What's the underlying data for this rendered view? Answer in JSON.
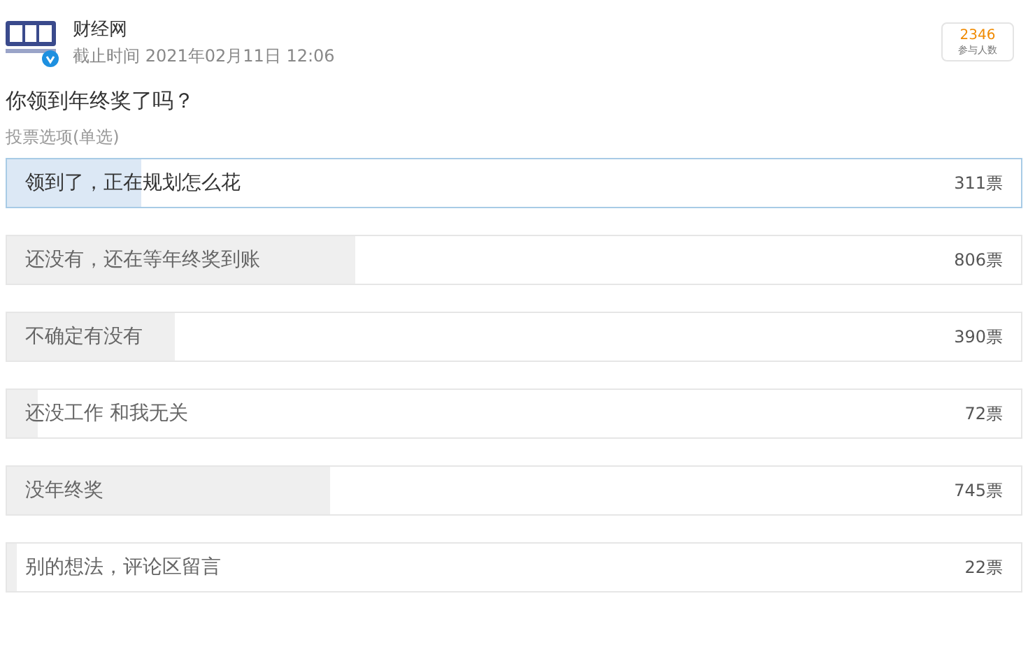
{
  "account": {
    "name": "财经网",
    "deadline": "截止时间 2021年02月11日 12:06",
    "verified": true
  },
  "participants": {
    "count": "2346",
    "label": "参与人数"
  },
  "question": "你领到年终奖了吗？",
  "options_label": "投票选项(单选)",
  "options": [
    {
      "text": "领到了，正在规划怎么花",
      "votes": "311票",
      "level": 0.133,
      "selected": true
    },
    {
      "text": "还没有，还在等年终奖到账",
      "votes": "806票",
      "level": 0.344,
      "selected": false
    },
    {
      "text": "不确定有没有",
      "votes": "390票",
      "level": 0.166,
      "selected": false
    },
    {
      "text": "还没工作 和我无关",
      "votes": "72票",
      "level": 0.031,
      "selected": false
    },
    {
      "text": "没年终奖",
      "votes": "745票",
      "level": 0.318,
      "selected": false
    },
    {
      "text": "别的想法，评论区留言",
      "votes": "22票",
      "level": 0.009,
      "selected": false
    }
  ]
}
